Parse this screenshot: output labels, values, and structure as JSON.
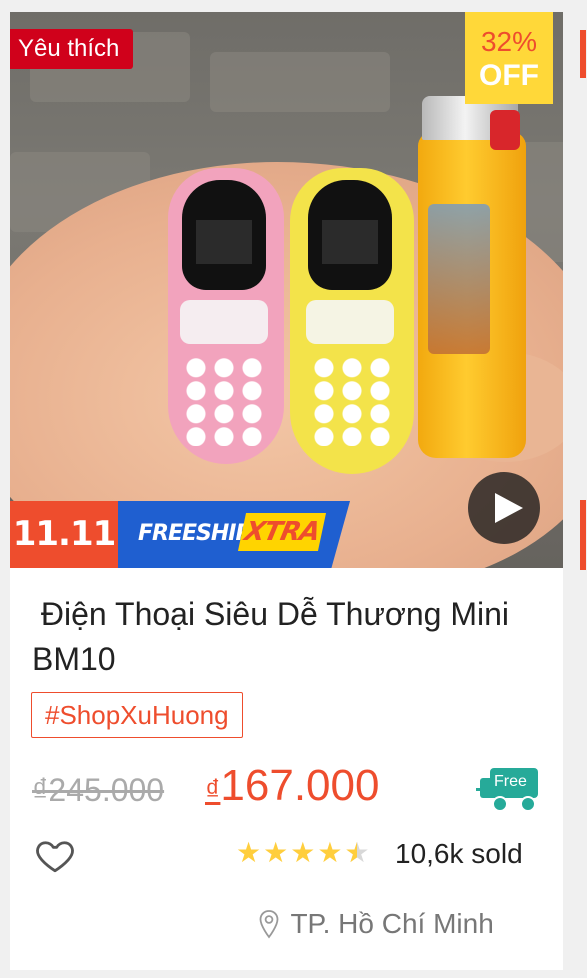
{
  "card": {
    "badge_favorite": "Yêu thích",
    "discount": {
      "percent": "32%",
      "off_label": "OFF"
    },
    "banner": {
      "event": "11.11",
      "freeship": "FREESHIP",
      "xtra": "XTRA"
    },
    "title": " Điện Thoại Siêu Dễ Thương Mini BM10",
    "hashtag": "#ShopXuHuong",
    "price": {
      "original": "₫245.000",
      "currency": "₫",
      "current": "167.000"
    },
    "free_shipping_label": "Free",
    "rating": {
      "value": 4.5,
      "max": 5
    },
    "sold": "10,6k sold",
    "location": "TP. Hồ Chí Minh"
  },
  "colors": {
    "brand": "#ee4d2d",
    "favorite_badge": "#d0011b",
    "discount_bg": "#ffd839",
    "freeship_blue": "#1f5fd0",
    "star": "#ffce3d",
    "free_truck": "#26aa99"
  },
  "icons": [
    "play-icon",
    "free-shipping-truck-icon",
    "heart-icon",
    "star-icon",
    "location-pin-icon"
  ]
}
